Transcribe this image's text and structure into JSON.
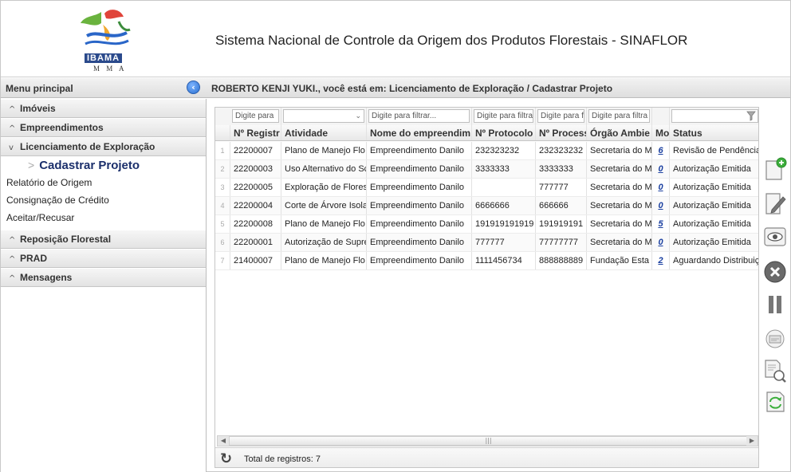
{
  "header": {
    "logo_text": "IBAMA",
    "logo_sub": "M M A",
    "title": "Sistema Nacional de Controle da Origem dos Produtos Florestais - SINAFLOR"
  },
  "topbar": {
    "menu_title": "Menu principal",
    "breadcrumb": "ROBERTO KENJI YUKI., você está em: Licenciamento de Exploração / Cadastrar Projeto"
  },
  "sidebar": {
    "sections": [
      {
        "label": "Imóveis",
        "expanded": false
      },
      {
        "label": "Empreendimentos",
        "expanded": false
      },
      {
        "label": "Licenciamento de Exploração",
        "expanded": true
      }
    ],
    "sub_items": [
      {
        "label": "Cadastrar Projeto",
        "active": true
      },
      {
        "label": "Relatório de Origem"
      },
      {
        "label": "Consignação de Crédito"
      },
      {
        "label": "Aceitar/Recusar"
      }
    ],
    "sections_after": [
      {
        "label": "Reposição Florestal"
      },
      {
        "label": "PRAD"
      },
      {
        "label": "Mensagens"
      }
    ]
  },
  "grid": {
    "filters": [
      "Digite para",
      "",
      "Digite para filtrar...",
      "Digite para filtra",
      "Digite para fi",
      "Digite para filtra",
      "",
      ""
    ],
    "columns": [
      "Nº Registr",
      "Atividade",
      "Nome do empreendim",
      "Nº Protocolo",
      "Nº Process",
      "Órgão Ambie",
      "Moc",
      "Status"
    ],
    "rows": [
      {
        "n": "1",
        "registro": "22200007",
        "atividade": "Plano de Manejo Flo",
        "nome": "Empreendimento Danilo",
        "protocolo": "232323232",
        "processo": "232323232",
        "orgao": "Secretaria do M",
        "mod": "6",
        "status": "Revisão de Pendência"
      },
      {
        "n": "2",
        "registro": "22200003",
        "atividade": "Uso Alternativo do Sc",
        "nome": "Empreendimento Danilo",
        "protocolo": "3333333",
        "processo": "3333333",
        "orgao": "Secretaria do M",
        "mod": "0",
        "status": "Autorização Emitida"
      },
      {
        "n": "3",
        "registro": "22200005",
        "atividade": "Exploração de Flores",
        "nome": "Empreendimento Danilo",
        "protocolo": "",
        "processo": "777777",
        "orgao": "Secretaria do M",
        "mod": "0",
        "status": "Autorização Emitida"
      },
      {
        "n": "4",
        "registro": "22200004",
        "atividade": "Corte de Árvore Isola",
        "nome": "Empreendimento Danilo",
        "protocolo": "6666666",
        "processo": "666666",
        "orgao": "Secretaria do M",
        "mod": "0",
        "status": "Autorização Emitida"
      },
      {
        "n": "5",
        "registro": "22200008",
        "atividade": "Plano de Manejo Flo",
        "nome": "Empreendimento Danilo",
        "protocolo": "191919191919",
        "processo": "191919191",
        "orgao": "Secretaria do M",
        "mod": "5",
        "status": "Autorização Emitida"
      },
      {
        "n": "6",
        "registro": "22200001",
        "atividade": "Autorização de Supre",
        "nome": "Empreendimento Danilo",
        "protocolo": "777777",
        "processo": "77777777",
        "orgao": "Secretaria do M",
        "mod": "0",
        "status": "Autorização Emitida"
      },
      {
        "n": "7",
        "registro": "21400007",
        "atividade": "Plano de Manejo Flo",
        "nome": "Empreendimento Danilo",
        "protocolo": "1111456734",
        "processo": "888888889",
        "orgao": "Fundação Esta",
        "mod": "2",
        "status": "Aguardando Distribuiç"
      }
    ],
    "footer_text": "Total de registros: 7",
    "scroll_grip": "|||"
  },
  "toolbar": {
    "tools": [
      "add-document-icon",
      "edit-icon",
      "view-eye-icon",
      "cancel-icon",
      "pause-icon",
      "card-icon",
      "document-search-icon",
      "document-refresh-icon"
    ]
  },
  "colors": {
    "accent": "#1b2f6b",
    "link": "#1a3fa0",
    "add_green": "#3cae3c",
    "cancel_gray": "#6a6a6a"
  }
}
